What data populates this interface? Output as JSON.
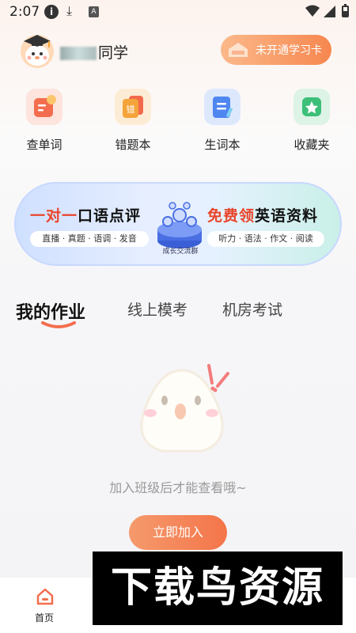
{
  "status_bar": {
    "time": "2:07",
    "icons": [
      "info-icon",
      "download-icon",
      "text-a-icon",
      "wifi-icon",
      "signal-icon",
      "battery-icon"
    ]
  },
  "header": {
    "app_name_suffix": "同学",
    "card_button_label": "未开通学习卡"
  },
  "quick_actions": [
    {
      "label": "查单词",
      "icon": "dictionary-icon",
      "color": "#f36e4e"
    },
    {
      "label": "错题本",
      "icon": "wrong-book-icon",
      "color": "#f4a43a"
    },
    {
      "label": "生词本",
      "icon": "vocabulary-book-icon",
      "color": "#4f86f0"
    },
    {
      "label": "收藏夹",
      "icon": "favorites-star-icon",
      "color": "#3dbf79"
    }
  ],
  "banner": {
    "left_title_red": "一对一",
    "left_title_black": "口语点评",
    "left_tags": "直播 · 真题 · 语调 · 发音",
    "middle_label": "成长交流群",
    "right_title_red": "免费领",
    "right_title_black": "英语资料",
    "right_tags": "听力 · 语法 · 作文 · 阅读"
  },
  "tabs": [
    {
      "label": "我的作业",
      "active": true
    },
    {
      "label": "线上模考",
      "active": false
    },
    {
      "label": "机房考试",
      "active": false
    }
  ],
  "empty_state": {
    "message": "加入班级后才能查看哦~",
    "join_button_label": "立即加入"
  },
  "bottom_nav": {
    "home_label": "首页"
  },
  "watermark": {
    "text": "下载鸟资源"
  },
  "colors": {
    "accent_orange": "#f4754a",
    "tab_underline": "#f36e4e"
  }
}
